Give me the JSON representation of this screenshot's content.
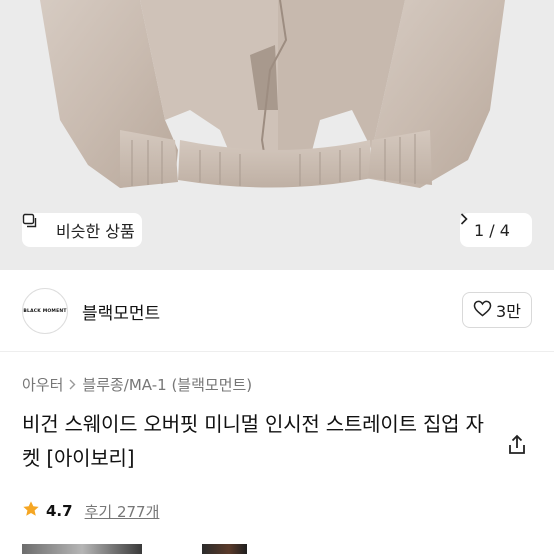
{
  "hero": {
    "similar_label": "비슷한 상품",
    "page_indicator": "1 / 4"
  },
  "brand": {
    "logo_text": "BLACK MOMENT",
    "name": "블랙모먼트",
    "like_count": "3만"
  },
  "breadcrumb": [
    "아우터",
    "블루종/MA-1 (블랙모먼트)"
  ],
  "product": {
    "title": "비건 스웨이드 오버핏 미니멀 인시전 스트레이트 집업 자켓 [아이보리]"
  },
  "rating": {
    "value": "4.7",
    "reviews": "후기 277개"
  },
  "colors": {
    "star": "#f5a623",
    "hero_bg": "#ebebeb"
  }
}
